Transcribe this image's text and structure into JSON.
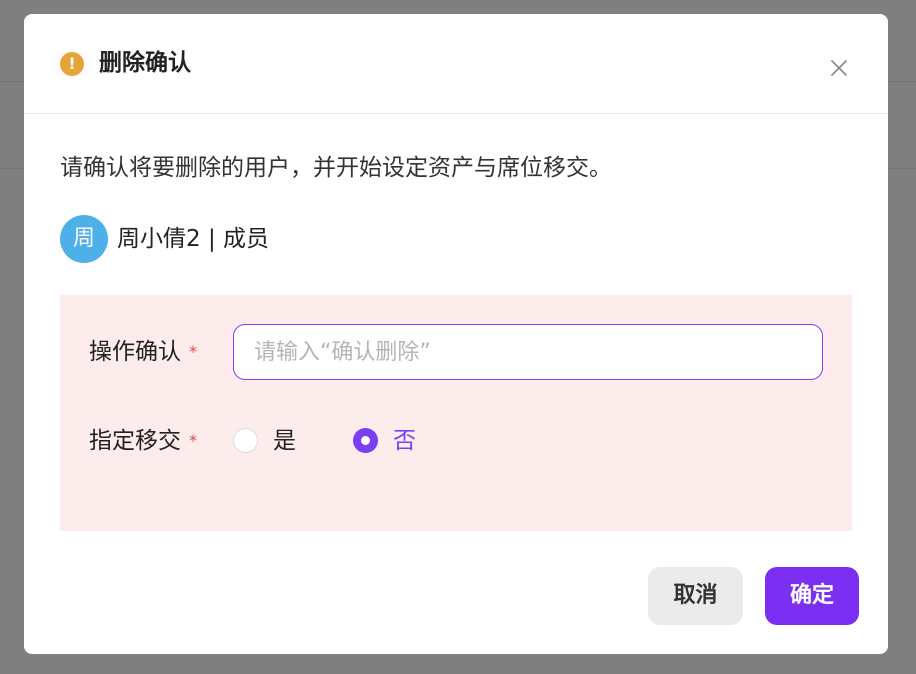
{
  "dialog": {
    "title": "删除确认",
    "warning_icon": "exclamation-circle-icon",
    "close_icon": "close-icon",
    "description": "请确认将要删除的用户，并开始设定资产与席位移交。"
  },
  "user": {
    "avatar_text": "周",
    "display": "周小倩2 | 成员",
    "avatar_color": "#4eb0e8"
  },
  "form": {
    "panel_color": "#fdecec",
    "confirm": {
      "label": "操作确认",
      "required_mark": "*",
      "placeholder": "请输入“确认删除”",
      "value": ""
    },
    "transfer": {
      "label": "指定移交",
      "required_mark": "*",
      "options": [
        {
          "label": "是",
          "selected": false
        },
        {
          "label": "否",
          "selected": true
        }
      ]
    }
  },
  "buttons": {
    "cancel": "取消",
    "ok": "确定"
  },
  "colors": {
    "accent": "#7b3ff2",
    "warning": "#e7a23a",
    "required": "#e5484d"
  }
}
